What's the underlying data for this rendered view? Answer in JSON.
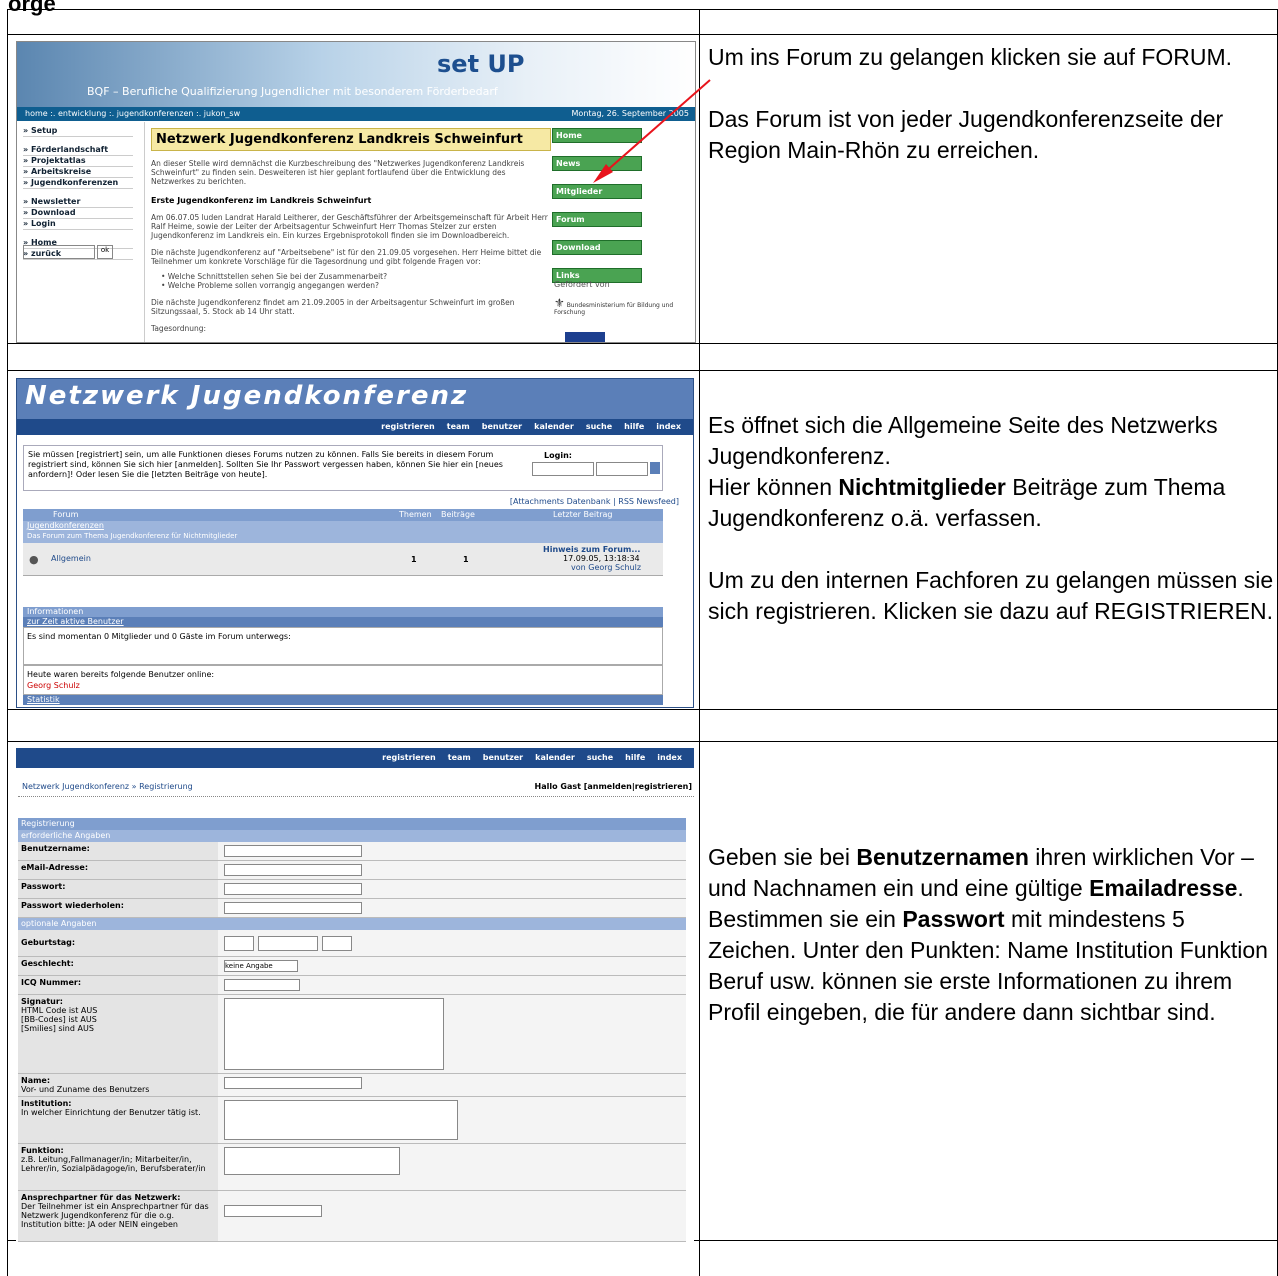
{
  "cut_heading": "orge",
  "rows": [
    {
      "text": [
        "Um ins Forum zu gelangen klicken sie auf FORUM.",
        "Das Forum ist von jeder Jugendkonferenzseite der Region Main-Rhön zu erreichen."
      ]
    },
    {
      "text_parts": [
        "Es öffnet sich die Allgemeine Seite des Netzwerks Jugendkonferenz.",
        "Hier können ",
        "Nichtmitglieder",
        " Beiträge zum Thema Jugendkonferenz o.ä. verfassen.",
        "Um zu den internen Fachforen zu gelangen müssen sie sich registrieren. Klicken sie dazu auf REGISTRIEREN."
      ]
    },
    {
      "text_parts": [
        "Geben sie bei ",
        "Benutzernamen",
        " ihren wirklichen Vor – und Nachnamen ein und eine gültige ",
        "Emailadresse",
        ". Bestimmen sie ein ",
        "Passwort",
        " mit mindestens 5 Zeichen. Unter den Punkten: Name Institution Funktion Beruf usw. können sie erste Informationen zu ihrem Profil eingeben, die für andere dann sichtbar sind."
      ]
    }
  ],
  "shot1": {
    "logo": "set UP",
    "subtitle": "BQF – Berufliche Qualifizierung Jugendlicher mit besonderem Förderbedarf",
    "crumb": "home :. entwicklung :. jugendkonferenzen :. jukon_sw",
    "date": "Montag, 26. September 2005",
    "menu": [
      "» Setup",
      "» Förderlandschaft",
      "» Projektatlas",
      "» Arbeitskreise",
      "» Jugendkonferenzen",
      "» Newsletter",
      "» Download",
      "» Login",
      "» Home",
      "» zurück"
    ],
    "search_btn": "ok",
    "heading": "Netzwerk Jugendkonferenz Landkreis Schweinfurt",
    "intro": "An dieser Stelle wird demnächst die Kurzbeschreibung des \"Netzwerkes Jugendkonferenz Landkreis Schweinfurt\" zu finden sein. Desweiteren ist hier geplant fortlaufend über die Entwicklung des Netzwerkes zu berichten.",
    "sub_heading": "Erste Jugendkonferenz im Landkreis Schweinfurt",
    "para2": "Am 06.07.05 luden Landrat Harald Leitherer, der Geschäftsführer der Arbeitsgemeinschaft für Arbeit Herr Ralf Heime, sowie der Leiter der Arbeitsagentur Schweinfurt Herr Thomas Stelzer zur ersten Jugendkonferenz im Landkreis ein. Ein kurzes Ergebnisprotokoll finden sie im Downloadbereich.",
    "para3": "Die nächste Jugendkonferenz auf \"Arbeitsebene\" ist für den 21.09.05 vorgesehen. Herr Heime bittet die Teilnehmer um konkrete Vorschläge für die Tagesordnung und gibt folgende Fragen vor:",
    "q1": "• Welche Schnittstellen sehen Sie bei der Zusammenarbeit?",
    "q2": "• Welche Probleme sollen vorrangig angegangen werden?",
    "para4": "Die nächste Jugendkonferenz findet am 21.09.2005 in der Arbeitsagentur Schweinfurt im großen Sitzungssaal, 5. Stock ab 14 Uhr statt.",
    "agenda": "Tagesordnung:",
    "buttons": [
      "Home",
      "News",
      "Mitglieder",
      "Forum",
      "Download",
      "Links"
    ],
    "funded": "Gefördert von",
    "ministry": "Bundesministerium für Bildung und Forschung"
  },
  "shot2": {
    "title": "Netzwerk Jugendkonferenz",
    "nav": [
      "registrieren",
      "team",
      "benutzer",
      "kalender",
      "suche",
      "hilfe",
      "index"
    ],
    "login_text": "Sie müssen [registriert] sein, um alle Funktionen dieses Forums nutzen zu können. Falls Sie bereits in diesem Forum registriert sind, können Sie sich hier [anmelden]. Sollten Sie Ihr Passwort vergessen haben, können Sie hier ein [neues anfordern]! Oder lesen Sie die [letzten Beiträge von heute].",
    "login_label": "Login:",
    "feeds": "[Attachments Datenbank | RSS Newsfeed]",
    "headers": [
      "Forum",
      "Themen",
      "Beiträge",
      "Letzter Beitrag"
    ],
    "category": "Jugendkonferenzen",
    "category_desc": "Das Forum zum Thema Jugendkonferenz für Nichtmitglieder",
    "forum_name": "Allgemein",
    "topics": "1",
    "posts": "1",
    "last_title": "Hinweis zum Forum...",
    "last_date": "17.09.05, 13:18:34",
    "last_by": "von Georg Schulz",
    "info_head": "Informationen",
    "active_head": "zur Zeit aktive Benutzer",
    "active_text": "Es sind momentan 0 Mitglieder und 0 Gäste im Forum unterwegs:",
    "today_text": "Heute waren bereits folgende Benutzer online:",
    "today_user": "Georg Schulz",
    "stats": "Statistik"
  },
  "shot3": {
    "nav": [
      "registrieren",
      "team",
      "benutzer",
      "kalender",
      "suche",
      "hilfe",
      "index"
    ],
    "crumb": "Netzwerk Jugendkonferenz  » Registrierung",
    "greeting": "Hallo Gast [anmelden|registrieren]",
    "section": "Registrierung",
    "required": "erforderliche Angaben",
    "optional": "optionale Angaben",
    "fields_req": [
      "Benutzername:",
      "eMail-Adresse:",
      "Passwort:",
      "Passwort wiederholen:"
    ],
    "birthday": "Geburtstag:",
    "gender": "Geschlecht:",
    "gender_value": "keine Angabe",
    "icq": "ICQ Nummer:",
    "sig": "Signatur:",
    "sig_note": "HTML Code ist AUS [BB-Codes] ist AUS [Smilies] sind AUS",
    "name": "Name:",
    "name_note": "Vor- und Zuname des Benutzers",
    "inst": "Institution:",
    "inst_note": "In welcher Einrichtung der Benutzer tätig ist.",
    "func": "Funktion:",
    "func_note": "z.B. Leitung,Fallmanager/in; Mitarbeiter/in, Lehrer/in, Sozialpädagoge/in, Berufsberater/in",
    "partner": "Ansprechpartner für das Netzwerk:",
    "partner_note": "Der Teilnehmer ist ein Ansprechpartner für das Netzwerk Jugendkonferenz für die o.g. Institution bitte: JA oder NEIN eingeben"
  },
  "colors": {
    "arrow": "#e8141c",
    "forum_blue": "#1f4a8a",
    "button_green": "#4aa352"
  }
}
